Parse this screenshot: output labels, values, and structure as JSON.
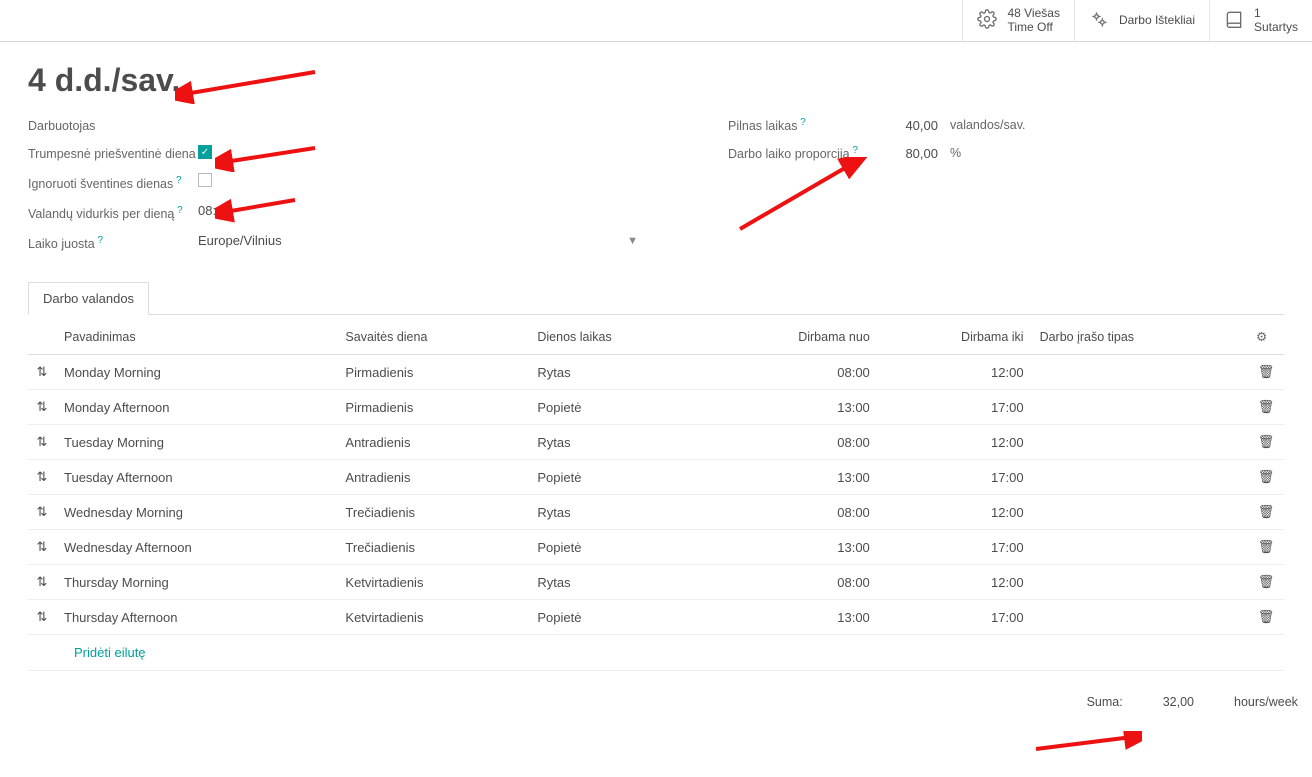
{
  "topbar": {
    "timeoff": {
      "count": "48",
      "label1": "Viešas",
      "label2": "Time Off"
    },
    "resources": {
      "label": "Darbo Ištekliai"
    },
    "contracts": {
      "count": "1",
      "label": "Sutartys"
    }
  },
  "title": "4 d.d./sav.",
  "labels": {
    "employee": "Darbuotojas",
    "shorter_preholiday": "Trumpesnė priešventinė diena",
    "ignore_holidays": "Ignoruoti šventines dienas",
    "avg_hours": "Valandų vidurkis per dieną",
    "timezone": "Laiko juosta",
    "full_time": "Pilnas laikas",
    "proportion": "Darbo laiko proporcija"
  },
  "values": {
    "avg_hours": "08:00",
    "timezone": "Europe/Vilnius",
    "full_time_num": "40,00",
    "full_time_unit": "valandos/sav.",
    "proportion_num": "80,00",
    "proportion_unit": "%"
  },
  "checks": {
    "shorter_preholiday": true,
    "ignore_holidays": false
  },
  "tab": {
    "label": "Darbo valandos"
  },
  "headers": {
    "name": "Pavadinimas",
    "weekday": "Savaitės diena",
    "daypart": "Dienos laikas",
    "from": "Dirbama nuo",
    "to": "Dirbama iki",
    "rectype": "Darbo įrašo tipas"
  },
  "rows": [
    {
      "name": "Monday Morning",
      "weekday": "Pirmadienis",
      "daypart": "Rytas",
      "from": "08:00",
      "to": "12:00"
    },
    {
      "name": "Monday Afternoon",
      "weekday": "Pirmadienis",
      "daypart": "Popietė",
      "from": "13:00",
      "to": "17:00"
    },
    {
      "name": "Tuesday Morning",
      "weekday": "Antradienis",
      "daypart": "Rytas",
      "from": "08:00",
      "to": "12:00"
    },
    {
      "name": "Tuesday Afternoon",
      "weekday": "Antradienis",
      "daypart": "Popietė",
      "from": "13:00",
      "to": "17:00"
    },
    {
      "name": "Wednesday Morning",
      "weekday": "Trečiadienis",
      "daypart": "Rytas",
      "from": "08:00",
      "to": "12:00"
    },
    {
      "name": "Wednesday Afternoon",
      "weekday": "Trečiadienis",
      "daypart": "Popietė",
      "from": "13:00",
      "to": "17:00"
    },
    {
      "name": "Thursday Morning",
      "weekday": "Ketvirtadienis",
      "daypart": "Rytas",
      "from": "08:00",
      "to": "12:00"
    },
    {
      "name": "Thursday Afternoon",
      "weekday": "Ketvirtadienis",
      "daypart": "Popietė",
      "from": "13:00",
      "to": "17:00"
    }
  ],
  "add_line": "Pridėti eilutę",
  "footer": {
    "label": "Suma:",
    "value": "32,00",
    "unit": "hours/week"
  }
}
